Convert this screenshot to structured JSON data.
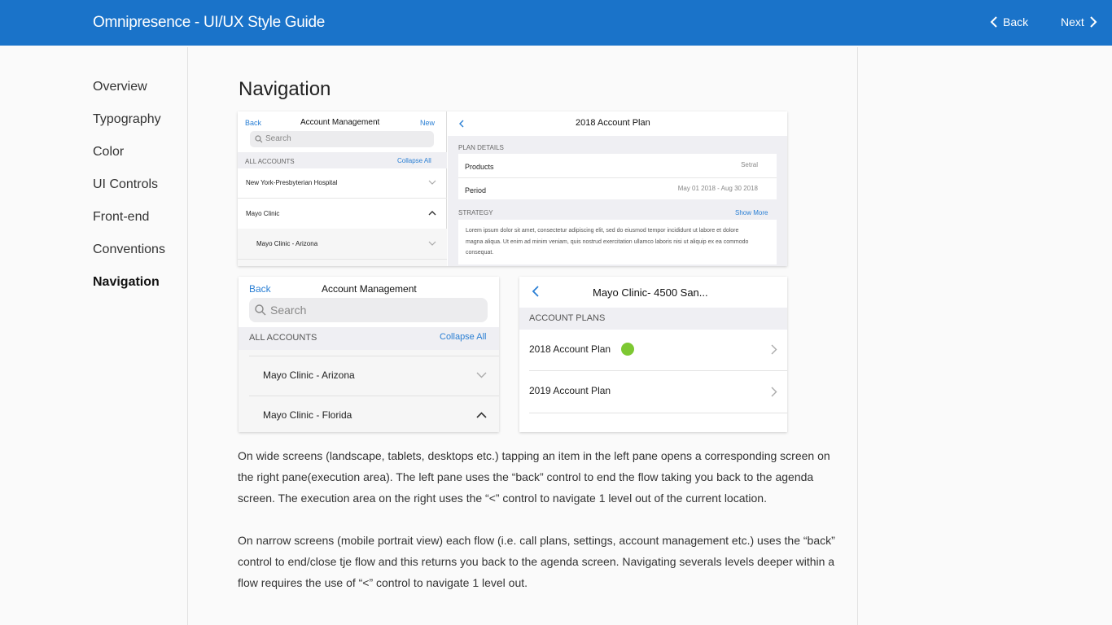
{
  "header": {
    "title": "Omnipresence - UI/UX Style Guide",
    "back_label": "Back",
    "next_label": "Next"
  },
  "sidebar": {
    "items": [
      {
        "label": "Overview"
      },
      {
        "label": "Typography"
      },
      {
        "label": "Color"
      },
      {
        "label": "UI Controls"
      },
      {
        "label": "Front-end"
      },
      {
        "label": "Conventions"
      },
      {
        "label": "Navigation"
      }
    ],
    "active": "Navigation"
  },
  "main": {
    "title": "Navigation",
    "paragraphs": [
      "On wide screens (landscape, tablets, desktops etc.) tapping an item in the left pane opens a corresponding screen on the right pane(execution area). The left pane uses the “back” control to end the flow taking you back to the agenda screen. The execution area on the right uses the “<” control to navigate 1 level out of the current location.",
      "On narrow screens (mobile portrait view) each flow (i.e. call plans, settings, account management etc.) uses the “back” control to end/close tje flow and this returns you back to the agenda screen. Navigating severals levels deeper within a flow requires the use of “<” control to navigate 1 level out."
    ]
  },
  "fig1": {
    "left": {
      "back": "Back",
      "title": "Account Management",
      "new": "New",
      "search_placeholder": "Search",
      "section": "ALL ACCOUNTS",
      "collapse": "Collapse All",
      "rows": [
        "New York-Presbyterian Hospital",
        "Mayo Clinic",
        "Mayo Clinic - Arizona"
      ]
    },
    "right": {
      "title": "2018 Account Plan",
      "section1": "PLAN DETAILS",
      "products_label": "Products",
      "products_value": "Setral",
      "period_label": "Period",
      "period_value": "May 01 2018 -  Aug 30 2018",
      "section2": "STRATEGY",
      "show_more": "Show More",
      "strategy_text": "Lorem ipsum dolor sit amet, consectetur adipiscing elit, sed do eiusmod tempor incididunt ut labore et dolore magna aliqua. Ut enim ad minim veniam, quis nostrud exercitation ullamco laboris nisi ut aliquip ex ea commodo consequat."
    }
  },
  "fig2": {
    "back": "Back",
    "title": "Account Management",
    "search_placeholder": "Search",
    "section": "ALL ACCOUNTS",
    "collapse": "Collapse All",
    "rows": [
      "Mayo Clinic - Arizona",
      "Mayo Clinic - Florida"
    ]
  },
  "fig3": {
    "title": "Mayo Clinic- 4500 San...",
    "section": "ACCOUNT PLANS",
    "rows": [
      "2018 Account Plan",
      "2019 Account Plan"
    ],
    "status_color": "#7dc832"
  },
  "colors": {
    "header": "#1a73c9",
    "link": "#2a7fd4"
  }
}
